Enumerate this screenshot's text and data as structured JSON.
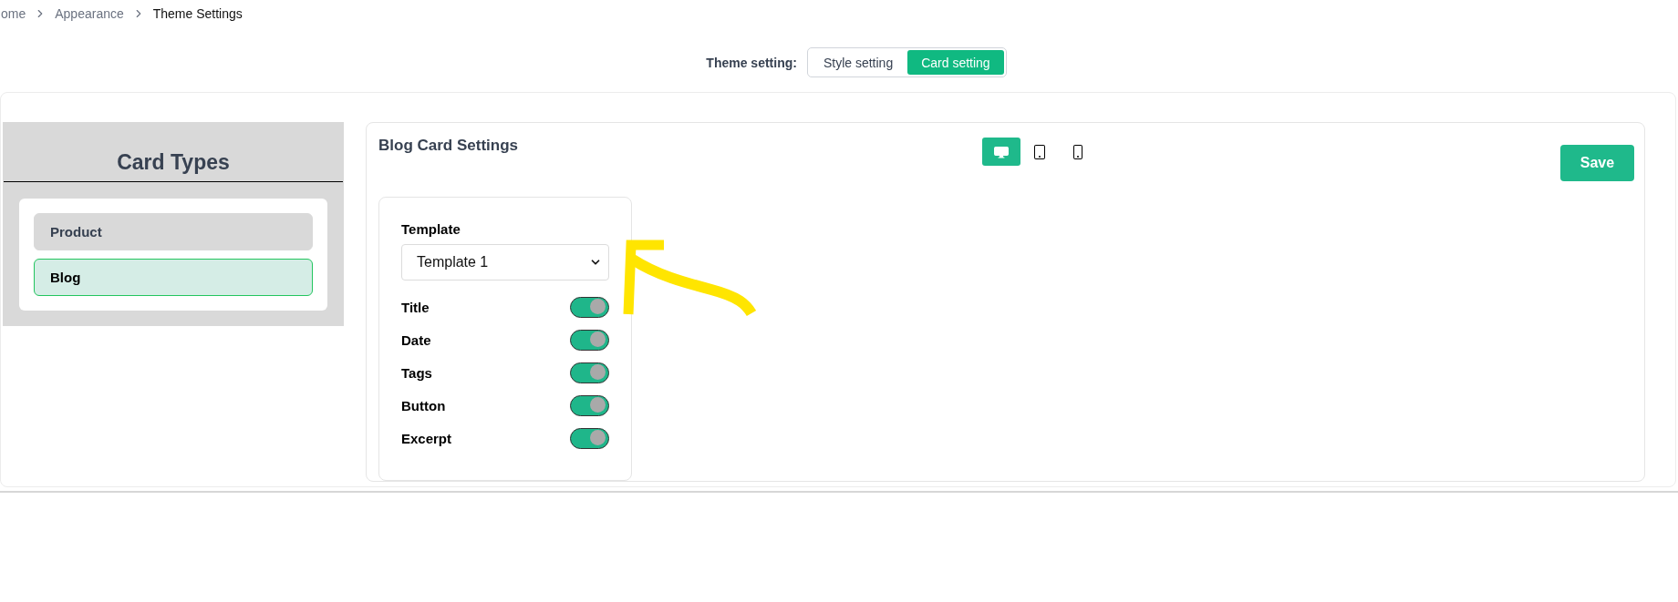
{
  "breadcrumb": [
    {
      "label": "ome",
      "current": false
    },
    {
      "label": "Appearance",
      "current": false
    },
    {
      "label": "Theme Settings",
      "current": true
    }
  ],
  "theme_setting": {
    "label": "Theme setting:",
    "options": [
      {
        "label": "Style setting",
        "selected": false
      },
      {
        "label": "Card setting",
        "selected": true
      }
    ]
  },
  "card_types": {
    "title": "Card Types",
    "items": [
      {
        "label": "Product",
        "selected": false
      },
      {
        "label": "Blog",
        "selected": true
      }
    ]
  },
  "card_settings": {
    "title": "Blog Card Settings",
    "devices": [
      {
        "kind": "desktop",
        "selected": true
      },
      {
        "kind": "tablet",
        "selected": false
      },
      {
        "kind": "mobile",
        "selected": false
      }
    ],
    "save_button": "Save",
    "template": {
      "label": "Template",
      "value": "Template 1"
    },
    "options": [
      {
        "label": "Title",
        "checked": true
      },
      {
        "label": "Date",
        "checked": true
      },
      {
        "label": "Tags",
        "checked": true
      },
      {
        "label": "Button",
        "checked": true
      },
      {
        "label": "Excerpt",
        "checked": true
      }
    ]
  }
}
